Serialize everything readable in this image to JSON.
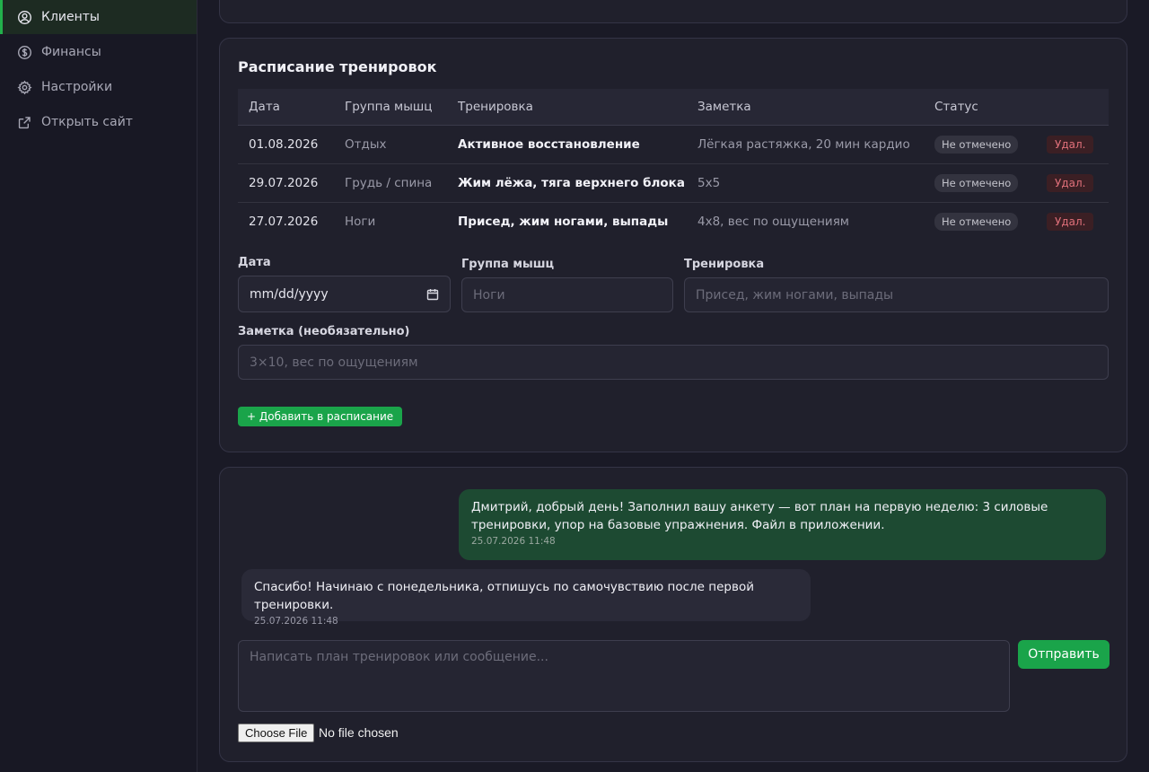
{
  "sidebar": {
    "items": [
      {
        "label": "Клиенты",
        "icon": "user-circle-icon",
        "active": true
      },
      {
        "label": "Финансы",
        "icon": "dollar-circle-icon",
        "active": false
      },
      {
        "label": "Настройки",
        "icon": "gear-icon",
        "active": false
      },
      {
        "label": "Открыть сайт",
        "icon": "external-link-icon",
        "active": false
      }
    ]
  },
  "schedule": {
    "title": "Расписание тренировок",
    "columns": [
      "Дата",
      "Группа мышц",
      "Тренировка",
      "Заметка",
      "Статус"
    ],
    "rows": [
      {
        "date": "01.08.2026",
        "group": "Отдых",
        "workout": "Активное восстановление",
        "note": "Лёгкая растяжка, 20 мин кардио",
        "status": "Не отмечено",
        "delete": "Удал."
      },
      {
        "date": "29.07.2026",
        "group": "Грудь / спина",
        "workout": "Жим лёжа, тяга верхнего блока",
        "note": "5x5",
        "status": "Не отмечено",
        "delete": "Удал."
      },
      {
        "date": "27.07.2026",
        "group": "Ноги",
        "workout": "Присед, жим ногами, выпады",
        "note": "4x8, вес по ощущениям",
        "status": "Не отмечено",
        "delete": "Удал."
      }
    ],
    "form": {
      "date_label": "Дата",
      "date_value": "mm/dd/yyyy",
      "group_label": "Группа мышц",
      "group_placeholder": "Ноги",
      "workout_label": "Тренировка",
      "workout_placeholder": "Присед, жим ногами, выпады",
      "note_label": "Заметка (необязательно)",
      "note_placeholder": "3×10, вес по ощущениям",
      "add_button": "+ Добавить в расписание"
    }
  },
  "chat": {
    "messages": [
      {
        "direction": "out",
        "text": "Дмитрий, добрый день! Заполнил вашу анкету — вот план на первую неделю: 3 силовые тренировки, упор на базовые упражнения. Файл в приложении.",
        "time": "25.07.2026 11:48"
      },
      {
        "direction": "in",
        "text": "Спасибо! Начинаю с понедельника, отпишусь по самочувствию после первой тренировки.",
        "time": "25.07.2026 11:48"
      }
    ],
    "compose_placeholder": "Написать план тренировок или сообщение...",
    "send_button": "Отправить",
    "file_button": "Choose File",
    "file_status": "No file chosen"
  },
  "colors": {
    "accent": "#1aa44a",
    "danger": "#e0707a",
    "background": "#1a1a26"
  }
}
